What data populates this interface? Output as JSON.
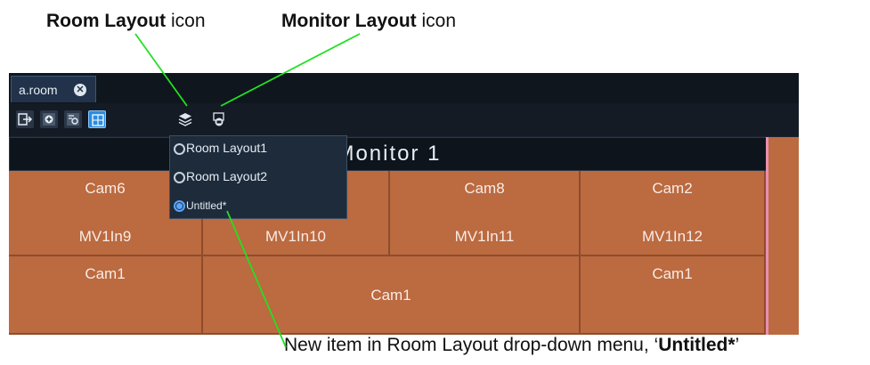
{
  "callouts": {
    "room_layout": {
      "bold": "Room Layout",
      "rest": " icon"
    },
    "monitor_layout": {
      "bold": "Monitor Layout",
      "rest": " icon"
    },
    "new_item": {
      "prefix": "New item in Room Layout drop-down menu, ‘",
      "bold": "Untitled*",
      "suffix": "’"
    }
  },
  "tab": {
    "label": "a.room",
    "close_symbol": "✕"
  },
  "toolbar": {
    "icons": [
      "exit-icon",
      "add-icon",
      "configure-icon",
      "grid-layout-icon",
      "room-layout-icon",
      "monitor-layout-icon"
    ]
  },
  "monitor": {
    "title": "Monitor 1"
  },
  "dropdown": {
    "options": [
      {
        "label": "Room Layout1",
        "selected": false
      },
      {
        "label": "Room Layout2",
        "selected": false
      },
      {
        "label": "Untitled*",
        "selected": true
      }
    ]
  },
  "cells": [
    {
      "top": "Cam6",
      "bottom": "MV1In9"
    },
    {
      "top": "",
      "bottom": "MV1In10"
    },
    {
      "top": "Cam8",
      "bottom": "MV1In11"
    },
    {
      "top": "Cam2",
      "bottom": "MV1In12"
    },
    {
      "top": "Cam1",
      "bottom": ""
    },
    {
      "top": "Cam1",
      "bottom": ""
    },
    {
      "top": "Cam1",
      "bottom": ""
    }
  ],
  "colors": {
    "accent_line": "#22e022",
    "cell": "#bc6a40",
    "header": "#0d141c",
    "selected_radio": "#5aa5ff"
  }
}
